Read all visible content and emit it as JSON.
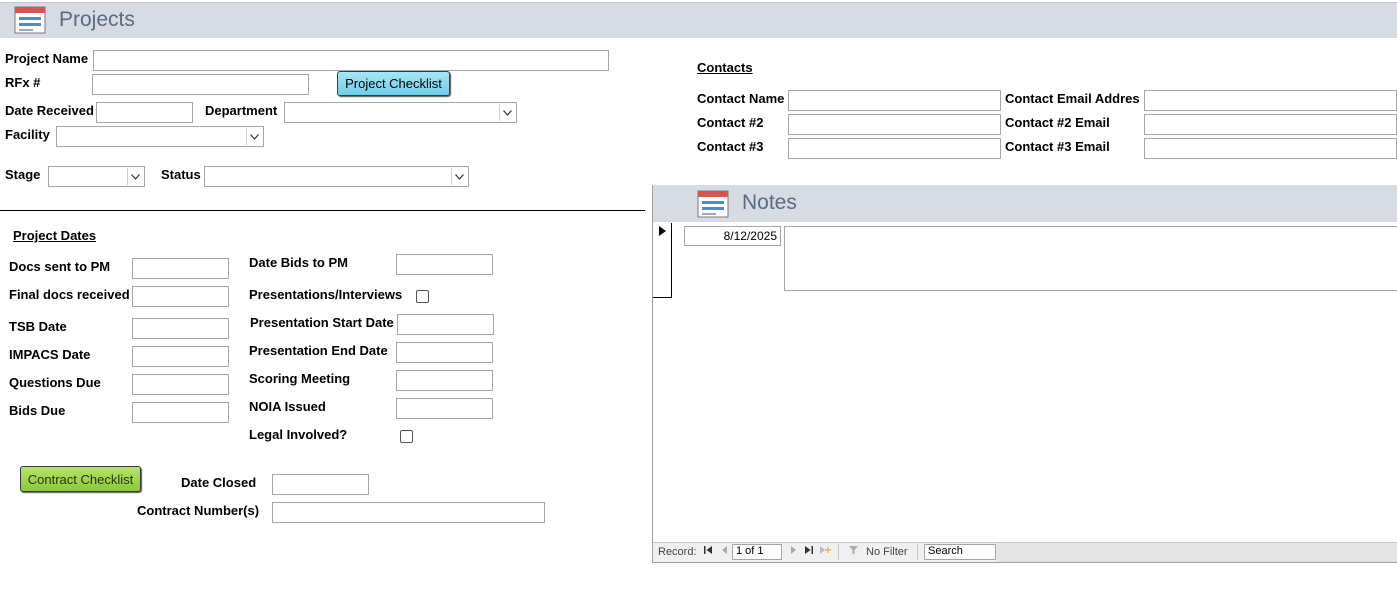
{
  "form": {
    "title": "Projects",
    "fields": {
      "project_name_label": "Project Name",
      "project_name_value": "",
      "rfx_label": "RFx #",
      "rfx_value": "",
      "date_received_label": "Date Received",
      "department_label": "Department",
      "facility_label": "Facility",
      "stage_label": "Stage",
      "status_label": "Status"
    },
    "project_checklist_button": "Project Checklist",
    "contract_checklist_button": "Contract Checklist"
  },
  "contacts": {
    "title": "Contacts",
    "contact_name_label": "Contact Name",
    "contact_email_label": "Contact Email Addres:",
    "contact2_label": "Contact #2",
    "contact2_email_label": "Contact #2 Email",
    "contact3_label": "Contact #3",
    "contact3_email_label": "Contact #3 Email"
  },
  "project_dates": {
    "title": "Project Dates",
    "docs_sent_label": "Docs sent to PM",
    "final_docs_label": "Final docs received",
    "tsb_label": "TSB Date",
    "impacs_label": "IMPACS Date",
    "questions_label": "Questions Due",
    "bids_due_label": "Bids Due",
    "date_bids_label": "Date Bids to PM",
    "presentations_label": "Presentations/Interviews",
    "pres_start_label": "Presentation Start Date",
    "pres_end_label": "Presentation End Date",
    "scoring_label": "Scoring Meeting",
    "noia_label": "NOIA Issued",
    "legal_label": "Legal Involved?",
    "presentations_checked": false,
    "legal_checked": false
  },
  "closing": {
    "date_closed_label": "Date Closed",
    "contract_numbers_label": "Contract Number(s)"
  },
  "notes": {
    "title": "Notes",
    "date_value": "8/12/2025",
    "note_text": ""
  },
  "record_nav": {
    "record_label": "Record:",
    "position": "1 of 1",
    "filter_label": "No Filter",
    "search_placeholder": "Search"
  },
  "colors": {
    "header_band": "#d6dbe4",
    "title_color": "#5b6b82",
    "project_checklist_btn": "#6fcde9",
    "contract_checklist_btn": "#8cc63f"
  }
}
